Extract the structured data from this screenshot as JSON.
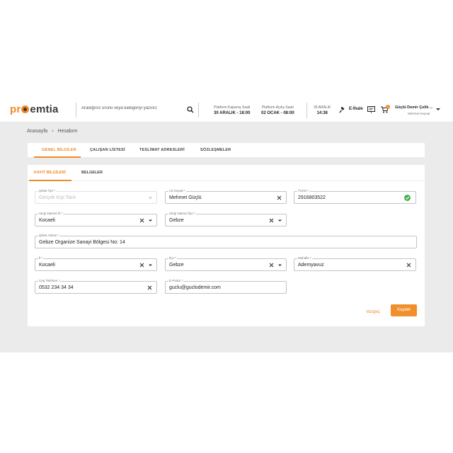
{
  "header": {
    "logo_pre": "pr",
    "logo_post": "emtia",
    "search_placeholder": "Aradığınız ürünü veya kategoriyi yazınız",
    "platform_close_label": "Platform Kapanış Saati",
    "platform_close_value": "30 ARALIK - 18:00",
    "platform_open_label": "Platform Açılış Saati",
    "platform_open_value": "02 OCAK - 08:00",
    "date_label": "30 ARALIK",
    "date_time": "14:38",
    "eihale": "E-İhale",
    "cart_count": "1",
    "user_name": "Güçlü Demir Çelik ...",
    "user_sub": "Mehmet Keynar"
  },
  "breadcrumb": {
    "home": "Anasayfa",
    "current": "Hesabım"
  },
  "tabs": [
    "GENEL BİLGİLER",
    "ÇALIŞAN LİSTESİ",
    "TESLİMAT ADRESLERİ",
    "SÖZLEŞMELER"
  ],
  "subtabs": [
    "KAYIT BİLGİLERİ",
    "BELGELER"
  ],
  "form": {
    "company_type": {
      "label": "Şirket Tipi *",
      "value": "Gerçek Kişi Tacir"
    },
    "name": {
      "label": "Ad Soyad *",
      "value": "Mehmet Güçlü"
    },
    "tckn": {
      "label": "TCKN *",
      "value": "2916803522"
    },
    "tax_city": {
      "label": "Vergi Dairesi İli *",
      "value": "Kocaeli"
    },
    "tax_district": {
      "label": "Vergi Dairesi İlçe *",
      "value": "Gebze"
    },
    "address": {
      "label": "Şirket Adresi *",
      "value": "Gebze Organize Sanayi Bölgesi No: 14"
    },
    "city": {
      "label": "İl *",
      "value": "Kocaeli"
    },
    "district": {
      "label": "İlçe *",
      "value": "Gebze"
    },
    "neighborhood": {
      "label": "Mahalle *",
      "value": "Ademyavuz"
    },
    "phone": {
      "label": "Cep Telefonu *",
      "value": "0532 234 34 34"
    },
    "email": {
      "label": "E-Posta *",
      "value": "guclu@guclodemir.com"
    }
  },
  "actions": {
    "cancel": "Vazgeç",
    "save": "Kaydet"
  },
  "colors": {
    "accent": "#f08a24",
    "success": "#4caf50"
  }
}
